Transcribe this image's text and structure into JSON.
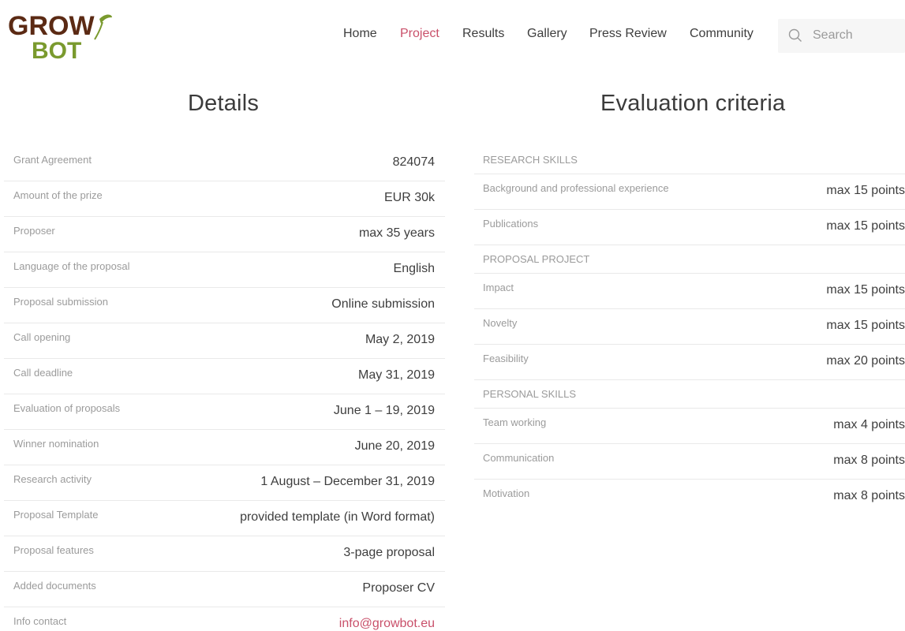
{
  "brand": {
    "logo_line1": "GROW",
    "logo_line2": "BOT",
    "colors": {
      "brown": "#5b2a14",
      "green": "#7a9a2e",
      "accent": "#c9506a"
    }
  },
  "nav": {
    "items": [
      {
        "label": "Home",
        "active": false
      },
      {
        "label": "Project",
        "active": true
      },
      {
        "label": "Results",
        "active": false
      },
      {
        "label": "Gallery",
        "active": false
      },
      {
        "label": "Press Review",
        "active": false
      },
      {
        "label": "Community",
        "active": false
      }
    ],
    "search_placeholder": "Search",
    "search_icon": "search-icon"
  },
  "details": {
    "title": "Details",
    "rows": [
      {
        "label": "Grant Agreement",
        "value": "824074"
      },
      {
        "label": "Amount of the prize",
        "value": "EUR 30k"
      },
      {
        "label": "Proposer",
        "value": "max 35 years"
      },
      {
        "label": "Language of the proposal",
        "value": "English"
      },
      {
        "label": "Proposal submission",
        "value": "Online submission"
      },
      {
        "label": "Call opening",
        "value": "May 2, 2019"
      },
      {
        "label": "Call deadline",
        "value": "May 31, 2019"
      },
      {
        "label": "Evaluation of proposals",
        "value": "June 1 – 19, 2019"
      },
      {
        "label": "Winner nomination",
        "value": "June 20, 2019"
      },
      {
        "label": "Research activity",
        "value": "1 August – December 31, 2019"
      },
      {
        "label": "Proposal Template",
        "value": "provided template (in Word format)"
      },
      {
        "label": "Proposal features",
        "value": "3-page proposal"
      },
      {
        "label": "Added documents",
        "value": "Proposer CV"
      },
      {
        "label": "Info contact",
        "value": "info@growbot.eu",
        "link": true
      }
    ]
  },
  "evaluation": {
    "title": "Evaluation criteria",
    "rows": [
      {
        "type": "category",
        "label": "RESEARCH SKILLS"
      },
      {
        "type": "item",
        "label": "Background and professional experience",
        "value": "max 15 points"
      },
      {
        "type": "item",
        "label": "Publications",
        "value": "max 15 points"
      },
      {
        "type": "category",
        "label": "PROPOSAL PROJECT"
      },
      {
        "type": "item",
        "label": "Impact",
        "value": "max 15 points"
      },
      {
        "type": "item",
        "label": "Novelty",
        "value": "max 15 points"
      },
      {
        "type": "item",
        "label": "Feasibility",
        "value": "max 20 points"
      },
      {
        "type": "category",
        "label": "PERSONAL SKILLS"
      },
      {
        "type": "item",
        "label": "Team working",
        "value": "max 4 points"
      },
      {
        "type": "item",
        "label": "Communication",
        "value": "max 8 points"
      },
      {
        "type": "item",
        "label": "Motivation",
        "value": "max 8 points"
      }
    ]
  }
}
